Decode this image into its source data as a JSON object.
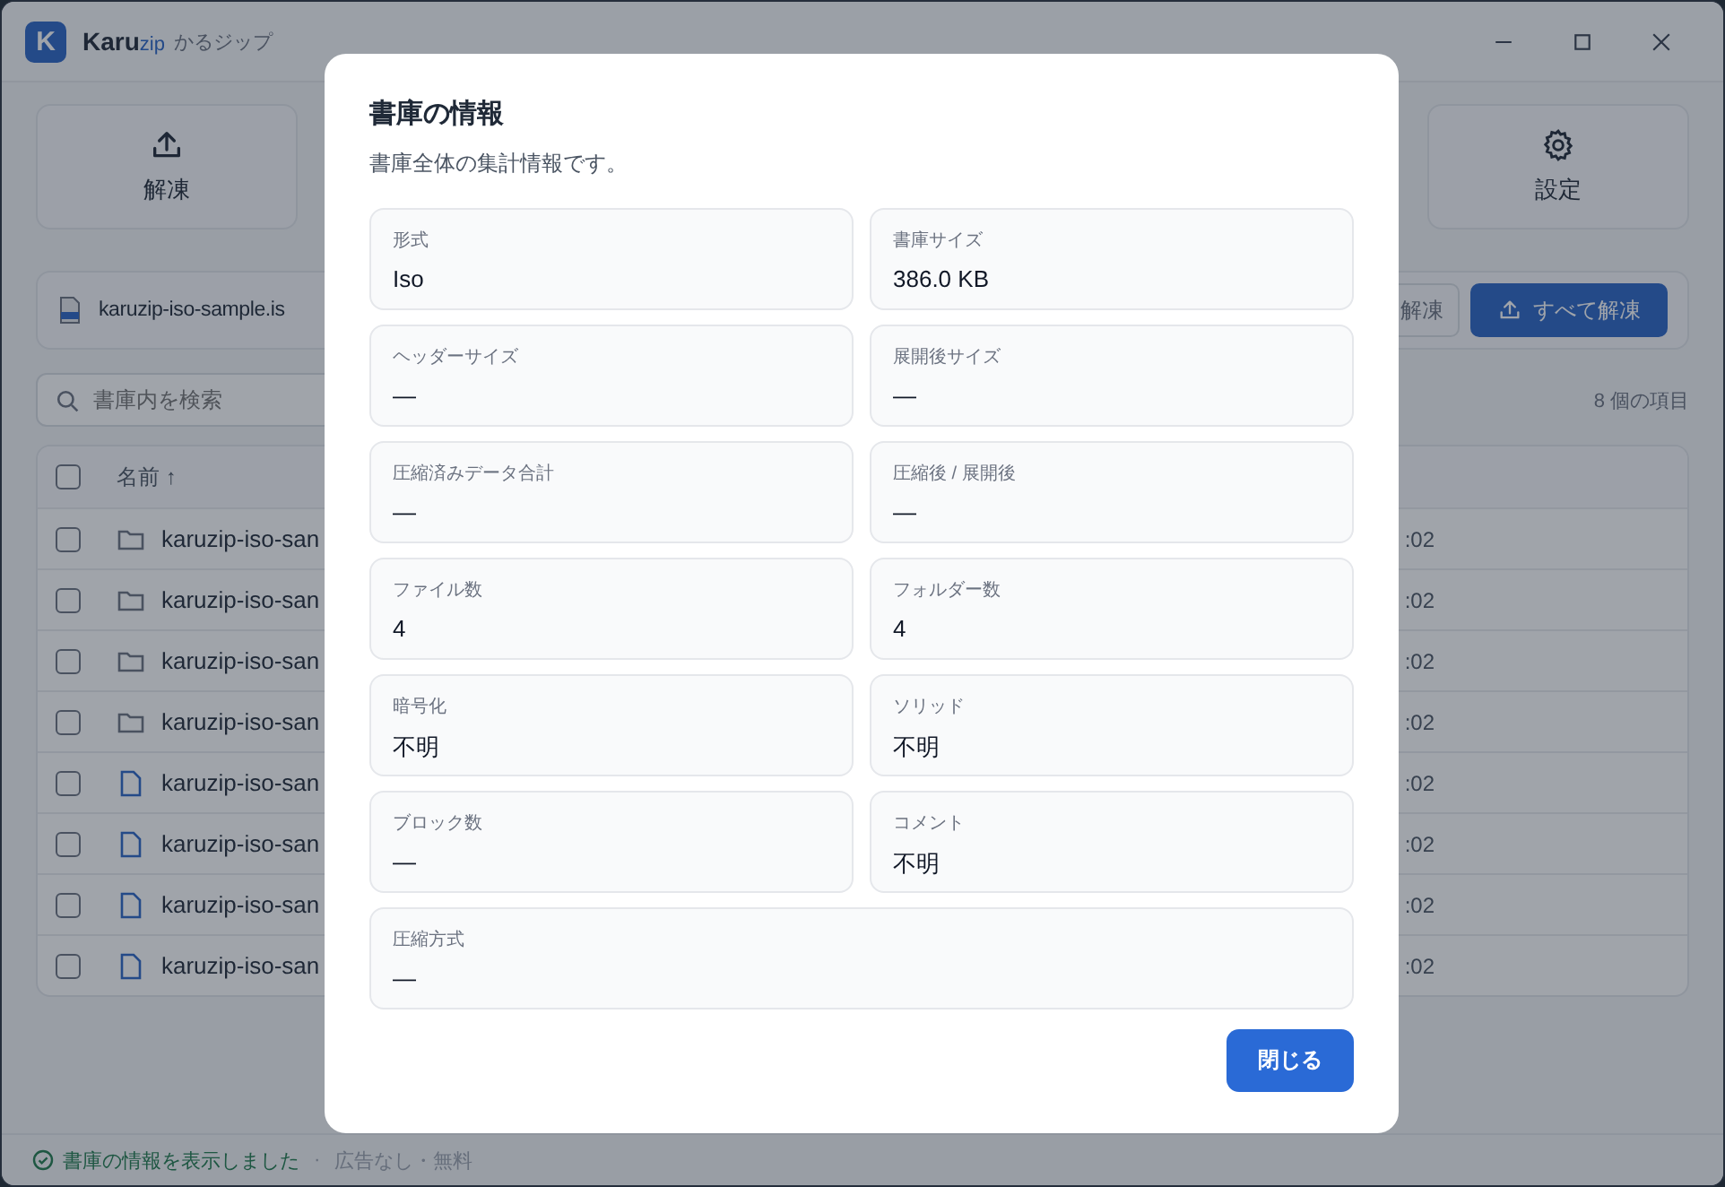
{
  "window": {
    "brand": "Karu",
    "brand_suffix": "zip",
    "subtitle": "かるジップ",
    "logo_letter": "K"
  },
  "toolbar": [
    {
      "label": "解凍"
    },
    {
      "label": "設定"
    }
  ],
  "file_bar": {
    "name": "karuzip-iso-sample.is",
    "buttons": [
      {
        "label": "解凍",
        "kind": "secondary"
      },
      {
        "label": "すべて解凍",
        "kind": "primary"
      }
    ]
  },
  "search": {
    "placeholder": "書庫内を検索"
  },
  "item_count": "8 個の項目",
  "table": {
    "header_checked": false,
    "columns": [
      {
        "label": "名前",
        "sort": "↑"
      }
    ],
    "rows": [
      {
        "kind": "folder",
        "name": "karuzip-iso-san",
        "time": ":02",
        "checked": false
      },
      {
        "kind": "folder",
        "name": "karuzip-iso-san",
        "time": ":02",
        "checked": false
      },
      {
        "kind": "folder",
        "name": "karuzip-iso-san",
        "time": ":02",
        "checked": false
      },
      {
        "kind": "folder",
        "name": "karuzip-iso-san",
        "time": ":02",
        "checked": false
      },
      {
        "kind": "file",
        "name": "karuzip-iso-san",
        "time": ":02",
        "checked": false
      },
      {
        "kind": "file",
        "name": "karuzip-iso-san",
        "time": ":02",
        "checked": false
      },
      {
        "kind": "file",
        "name": "karuzip-iso-san",
        "time": ":02",
        "checked": false
      },
      {
        "kind": "file",
        "name": "karuzip-iso-san",
        "time": ":02",
        "checked": false
      }
    ]
  },
  "status_bar": {
    "message": "書庫の情報を表示しました",
    "separator": "·",
    "note": "広告なし・無料"
  },
  "dialog": {
    "title": "書庫の情報",
    "subtitle": "書庫全体の集計情報です。",
    "fields": [
      {
        "label": "形式",
        "value": "Iso"
      },
      {
        "label": "書庫サイズ",
        "value": "386.0 KB"
      },
      {
        "label": "ヘッダーサイズ",
        "value": "—"
      },
      {
        "label": "展開後サイズ",
        "value": "—"
      },
      {
        "label": "圧縮済みデータ合計",
        "value": "—"
      },
      {
        "label": "圧縮後 / 展開後",
        "value": "—"
      },
      {
        "label": "ファイル数",
        "value": "4"
      },
      {
        "label": "フォルダー数",
        "value": "4"
      },
      {
        "label": "暗号化",
        "value": "不明"
      },
      {
        "label": "ソリッド",
        "value": "不明"
      },
      {
        "label": "ブロック数",
        "value": "—"
      },
      {
        "label": "コメント",
        "value": "不明"
      },
      {
        "label": "圧縮方式",
        "value": "—",
        "wide": true
      }
    ],
    "close_button": "閉じる"
  }
}
